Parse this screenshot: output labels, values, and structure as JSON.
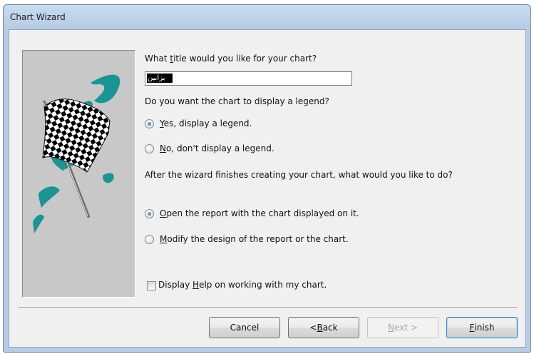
{
  "window": {
    "title": "Chart Wizard"
  },
  "prompt_title": {
    "label_before": "What ",
    "label_accel": "t",
    "label_after": "itle would you like for your chart?",
    "value": "بزابين"
  },
  "legend_prompt": "Do you want the chart to display a legend?",
  "legend_options": [
    {
      "accel": "Y",
      "rest": "es, display a legend.",
      "checked": true
    },
    {
      "accel": "N",
      "rest": "o, don't display a legend.",
      "checked": false
    }
  ],
  "after_prompt": "After the wizard finishes creating your chart, what would you like to do?",
  "after_options": [
    {
      "accel": "O",
      "rest": "pen the report with the chart displayed on it.",
      "checked": true
    },
    {
      "accel": "M",
      "rest": "odify the design of the report or the chart.",
      "checked": false
    }
  ],
  "help_checkbox": {
    "before": "Display ",
    "accel": "H",
    "after": "elp on working with my chart.",
    "checked": false
  },
  "buttons": {
    "cancel": "Cancel",
    "back": {
      "before": "< ",
      "accel": "B",
      "after": "ack"
    },
    "next": {
      "accel": "N",
      "after": "ext >"
    },
    "finish": {
      "accel": "F",
      "after": "inish"
    }
  },
  "colors": {
    "titlebar": "#b7cde6",
    "art_bg": "#c8c8c8",
    "teal": "#1a9494",
    "radio_dot": "#1f5fb7"
  }
}
